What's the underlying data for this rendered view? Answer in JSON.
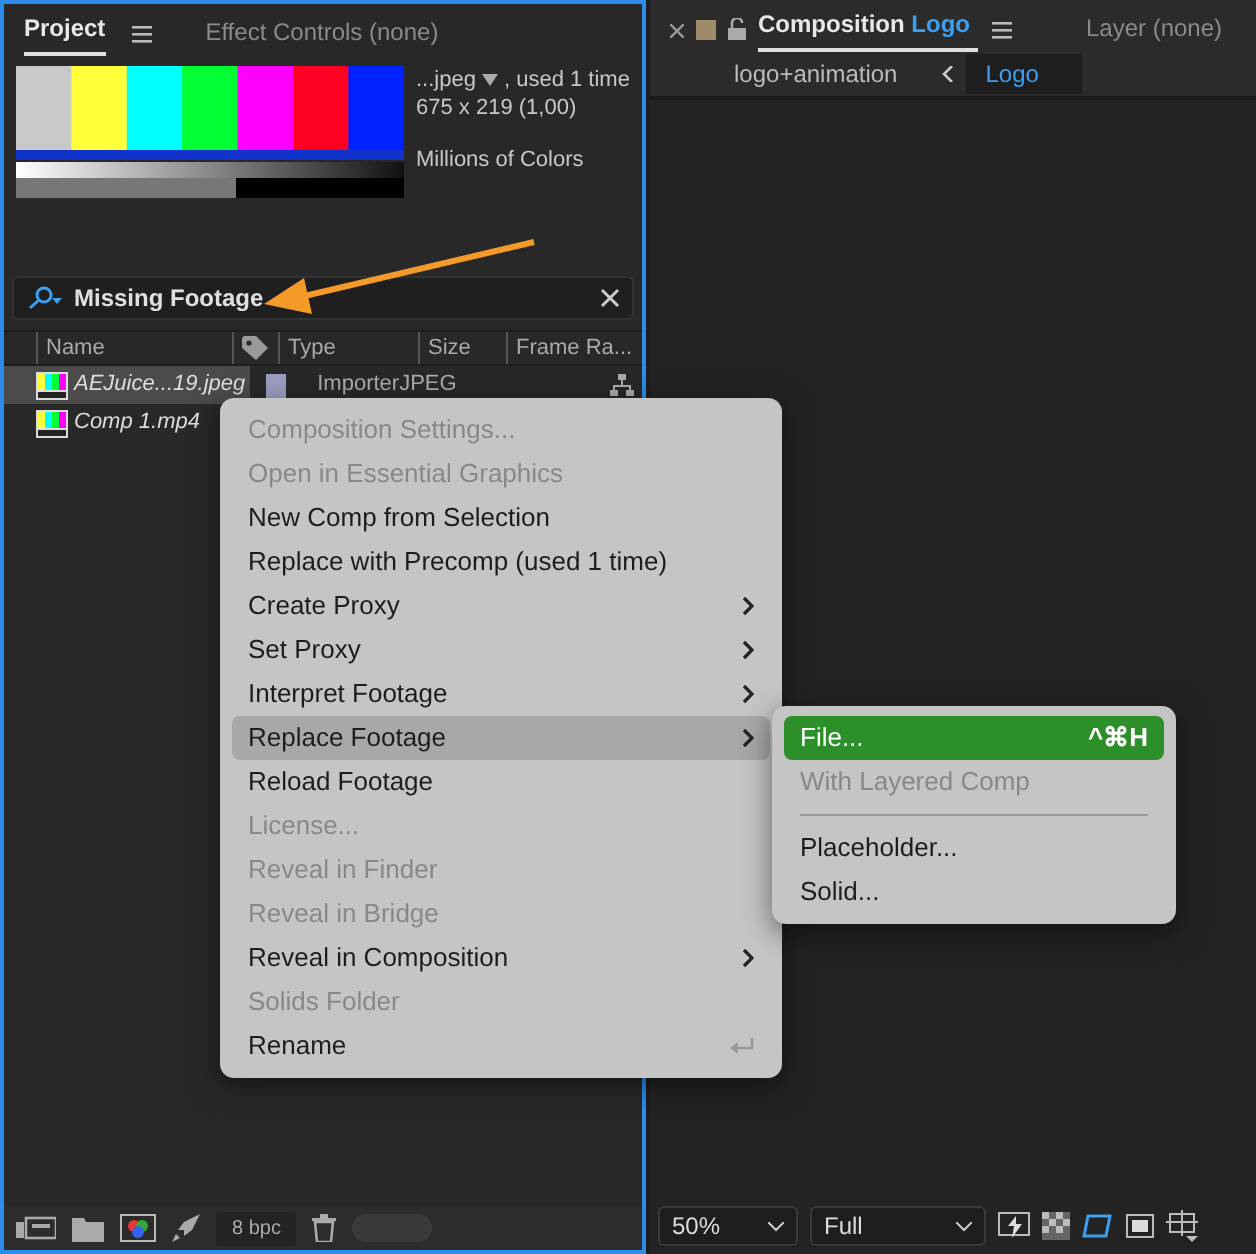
{
  "project_panel": {
    "tabs": [
      {
        "label": "Project",
        "selected": true
      },
      {
        "label": "Effect Controls (none)",
        "selected": false
      }
    ],
    "info": {
      "name": "...jpeg",
      "usage": ", used 1 time",
      "dimensions": "675 x 219 (1,00)",
      "colors": "Millions of Colors"
    },
    "search": {
      "value": "Missing Footage"
    },
    "columns": [
      "Name",
      "Type",
      "Size",
      "Frame Ra..."
    ],
    "rows": [
      {
        "name": "AEJuice...19.jpeg",
        "type": "ImporterJPEG",
        "color": "#9c9cc0",
        "selected": true
      },
      {
        "name": "Comp 1.mp4",
        "selected": false
      }
    ],
    "bit_depth": "8 bpc"
  },
  "composition_panel": {
    "tabs": [
      {
        "label": "Composition",
        "suffix": "Logo",
        "selected": true
      },
      {
        "label": "Layer (none)",
        "selected": false
      }
    ],
    "breadcrumbs": [
      {
        "label": "logo+animation",
        "selected": false
      },
      {
        "label": "Logo",
        "selected": true
      }
    ],
    "zoom": "50%",
    "resolution": "Full"
  },
  "context_menu": [
    {
      "label": "Composition Settings...",
      "disabled": true,
      "submenu": false,
      "selected": false
    },
    {
      "label": "Open in Essential Graphics",
      "disabled": true,
      "submenu": false,
      "selected": false
    },
    {
      "label": "New Comp from Selection",
      "disabled": false,
      "submenu": false,
      "selected": false
    },
    {
      "label": "Replace with Precomp (used 1 time)",
      "disabled": false,
      "submenu": false,
      "selected": false
    },
    {
      "label": "Create Proxy",
      "disabled": false,
      "submenu": true,
      "selected": false
    },
    {
      "label": "Set Proxy",
      "disabled": false,
      "submenu": true,
      "selected": false
    },
    {
      "label": "Interpret Footage",
      "disabled": false,
      "submenu": true,
      "selected": false
    },
    {
      "label": "Replace Footage",
      "disabled": false,
      "submenu": true,
      "selected": true
    },
    {
      "label": "Reload Footage",
      "disabled": false,
      "submenu": false,
      "selected": false
    },
    {
      "label": "License...",
      "disabled": true,
      "submenu": false,
      "selected": false
    },
    {
      "label": "Reveal in Finder",
      "disabled": true,
      "submenu": false,
      "selected": false
    },
    {
      "label": "Reveal in Bridge",
      "disabled": true,
      "submenu": false,
      "selected": false
    },
    {
      "label": "Reveal in Composition",
      "disabled": false,
      "submenu": true,
      "selected": false
    },
    {
      "label": "Solids Folder",
      "disabled": true,
      "submenu": false,
      "selected": false
    },
    {
      "label": "Rename",
      "disabled": false,
      "submenu": false,
      "selected": false,
      "return_key": true
    }
  ],
  "submenu": [
    {
      "kind": "item",
      "label": "File...",
      "shortcut": "^⌘H",
      "disabled": false,
      "selected": true
    },
    {
      "kind": "item",
      "label": "With Layered Comp",
      "disabled": true,
      "selected": false
    },
    {
      "kind": "separator"
    },
    {
      "kind": "item",
      "label": "Placeholder...",
      "disabled": false,
      "selected": false
    },
    {
      "kind": "item",
      "label": "Solid...",
      "disabled": false,
      "selected": false
    }
  ]
}
